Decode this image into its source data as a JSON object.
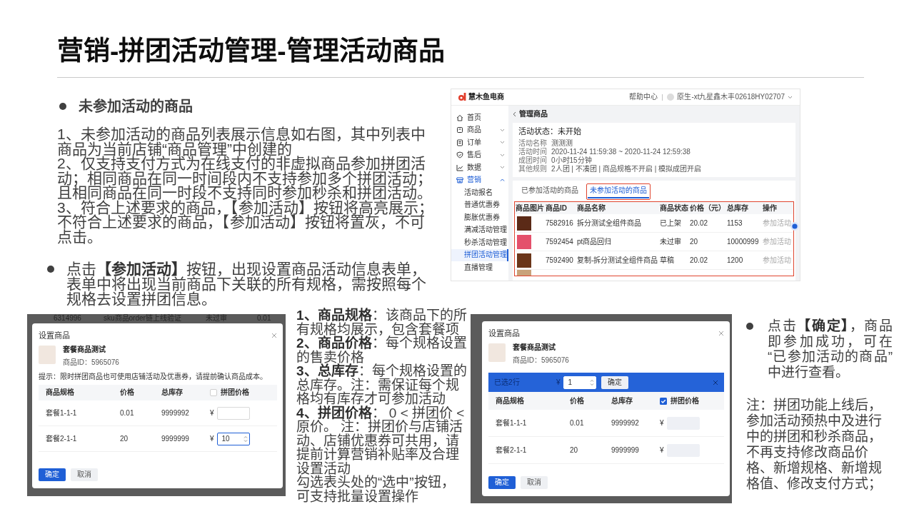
{
  "title": "营销-拼团活动管理-管理活动商品",
  "unjoined_section": {
    "heading": "未参加活动的商品",
    "paragraphs": [
      "1、未参加活动的商品列表展示信息如右图，其中列表中商品为当前店铺“商品管理”中创建的",
      "2、仅支持支付方式为在线支付的非虚拟商品参加拼团活动；相同商品在同一时间段内不支持参加多个拼团活动；且相同商品在同一时段不支持同时参加秒杀和拼团活动。",
      "3、符合上述要求的商品，【参加活动】按钮将高亮展示；不符合上述要求的商品，【参加活动】按钮将置灰，不可点击。"
    ]
  },
  "join_bullet": "点击**【参加活动】**按钮，出现设置商品活动信息表单，表单中将出现当前商品下关联的所有规格，需按照每个规格去设置拼团信息。",
  "admin_screenshot": {
    "brand": "慧木鱼电商",
    "help_link": "帮助中心",
    "user_name": "原生-xt九星鑫木丰02618HY02707",
    "sidebar": [
      {
        "label": "首页",
        "kind": "link",
        "selected": false
      },
      {
        "label": "商品",
        "kind": "group",
        "expanded": false,
        "selected": false
      },
      {
        "label": "订单",
        "kind": "group",
        "expanded": false,
        "selected": false
      },
      {
        "label": "售后",
        "kind": "group",
        "expanded": false,
        "selected": false
      },
      {
        "label": "数据",
        "kind": "group",
        "expanded": false,
        "selected": false
      },
      {
        "label": "营销",
        "kind": "group",
        "expanded": true,
        "selected": true,
        "children": [
          {
            "label": "活动报名",
            "selected": false
          },
          {
            "label": "普通优惠券",
            "selected": false
          },
          {
            "label": "膨胀优惠券",
            "selected": false
          },
          {
            "label": "满减活动管理",
            "selected": false
          },
          {
            "label": "秒杀活动管理",
            "selected": false
          },
          {
            "label": "拼团活动管理",
            "selected": true
          },
          {
            "label": "直播管理",
            "selected": false
          }
        ]
      }
    ],
    "page_title": "管理商品",
    "status": "活动状态：未开始",
    "info": [
      {
        "label": "活动名称",
        "value": "测测测"
      },
      {
        "label": "活动时间",
        "value": "2020-11-24 11:59:38 ~ 2020-11-24 12:59:38"
      },
      {
        "label": "成团时间",
        "value": "0小时15分钟"
      },
      {
        "label": "其他规则",
        "value": "2人团 | 不凑团 | 商品规格不开启 | 模拟成团开启"
      }
    ],
    "tabs": [
      {
        "label": "已参加活动的商品",
        "selected": false,
        "highlighted": false
      },
      {
        "label": "未参加活动的商品",
        "selected": true,
        "highlighted": true
      }
    ],
    "table": {
      "highlighted": true,
      "columns": [
        "商品图片",
        "商品ID",
        "商品名称",
        "商品状态",
        "价格（元）",
        "总库存",
        "操作"
      ],
      "rows": [
        {
          "id": "7582916",
          "name": "拆分测试全组件商品",
          "status": "已上架",
          "price": "20.02",
          "stock": "1153",
          "action": "参加活动",
          "disabled": true
        },
        {
          "id": "7592454",
          "name": "pt商品回归",
          "status": "未过审",
          "price": "20",
          "stock": "10000999",
          "action": "参加活动",
          "disabled": true
        },
        {
          "id": "7592490",
          "name": "复制-拆分测试全组件商品",
          "status": "草稿",
          "price": "20.02",
          "stock": "1200",
          "action": "参加活动",
          "disabled": true
        }
      ]
    }
  },
  "dialog_single": {
    "backdrop_row": [
      "6314996",
      "sku商品order链上线验证",
      "未过审",
      "0.01"
    ],
    "title": "设置商品",
    "product_name": "套餐商品测试",
    "product_id": "商品ID：5965076",
    "tip": "提示：限时拼团商品也可使用店铺活动及优惠券，请提前确认商品成本。",
    "columns": [
      "商品规格",
      "价格",
      "总库存",
      "拼团价格"
    ],
    "select_all_checked": false,
    "rows": [
      {
        "spec": "套餐1-1-1",
        "price": "0.01",
        "stock": "9999992",
        "currency": "¥",
        "focused": false,
        "disabled": false
      },
      {
        "spec": "套餐2-1-1",
        "price": "20",
        "stock": "9999999",
        "currency": "¥",
        "value": "10",
        "focused": true,
        "disabled": false
      }
    ],
    "buttons": [
      {
        "label": "确定",
        "primary": true
      },
      {
        "label": "取消",
        "primary": false
      }
    ]
  },
  "field_notes": [
    "**1、商品规格**：该商品下的所有规格均展示，包含套餐项",
    "**2、商品价格**：每个规格设置的售卖价格",
    "**3、总库存**：每个规格设置的总库存。注：需保证每个规格均有库存才可参加活动",
    "**4、拼团价格**： 0 < 拼团价 < 原价。 注：拼团价与店铺活动、店铺优惠券可共用，请提前计算营销补贴率及合理设置活动",
    "勾选表头处的“选中”按钮，可支持批量设置操作"
  ],
  "dialog_batch": {
    "title": "设置商品",
    "product_name": "套餐商品测试",
    "product_id": "商品ID：5965076",
    "batch_bar": {
      "selected_count": "已选2行",
      "currency": "¥",
      "value": "1",
      "confirm": "确定"
    },
    "columns": [
      "商品规格",
      "价格",
      "总库存",
      "拼团价格"
    ],
    "select_all_checked": true,
    "rows": [
      {
        "spec": "套餐1-1-1",
        "price": "0.01",
        "stock": "9999992",
        "currency": "¥",
        "focused": false,
        "disabled": true
      },
      {
        "spec": "套餐2-1-1",
        "price": "20",
        "stock": "9999999",
        "currency": "¥",
        "focused": false,
        "disabled": true
      }
    ],
    "buttons": [
      {
        "label": "确定",
        "primary": true
      },
      {
        "label": "取消",
        "primary": false
      }
    ]
  },
  "confirm_bullet": "点击**【确定】**，商品即参加成功，可在“已参加活动的商品”中进行查看。",
  "note": "注：拼团功能上线后，参加活动预热中及进行中的拼团和秒杀商品，不再支持修改商品价格、新增规格、新增规格值、修改支付方式；"
}
